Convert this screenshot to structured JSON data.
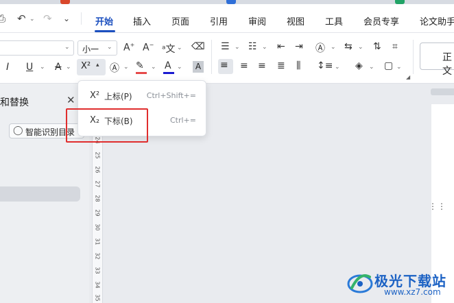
{
  "colors": {
    "accent": "#1b4fbf",
    "highlight_box": "#e02d2d",
    "font_color_bar": "#1a1ad0",
    "highlight_color_bar": "#e64a4a",
    "watermark": "#1c62c4"
  },
  "menubar": {
    "tabs": [
      "开始",
      "插入",
      "页面",
      "引用",
      "审阅",
      "视图",
      "工具",
      "会员专享",
      "论文助手"
    ],
    "active_tab": "开始",
    "quick_icons": [
      "save-icon",
      "undo-icon",
      "redo-icon",
      "more-chevron-icon"
    ]
  },
  "ribbon": {
    "font_name": "",
    "font_size": "小一",
    "superscript_label": "X²",
    "style_box_label": "正文"
  },
  "left_panel": {
    "title": "和替换",
    "close_label": "✕",
    "smart_toc_button": "智能识别目录"
  },
  "ruler": {
    "numbers": [
      "24",
      "25",
      "26",
      "27",
      "28",
      "29",
      "30",
      "31",
      "32",
      "33",
      "34",
      "35"
    ]
  },
  "dropdown": {
    "items": [
      {
        "icon": "X²",
        "label": "上标(P)",
        "shortcut": "Ctrl+Shift+="
      },
      {
        "icon": "X₂",
        "label": "下标(B)",
        "shortcut": "Ctrl+="
      }
    ]
  },
  "watermark": {
    "title": "极光下载站",
    "url": "www.xz7.com"
  }
}
